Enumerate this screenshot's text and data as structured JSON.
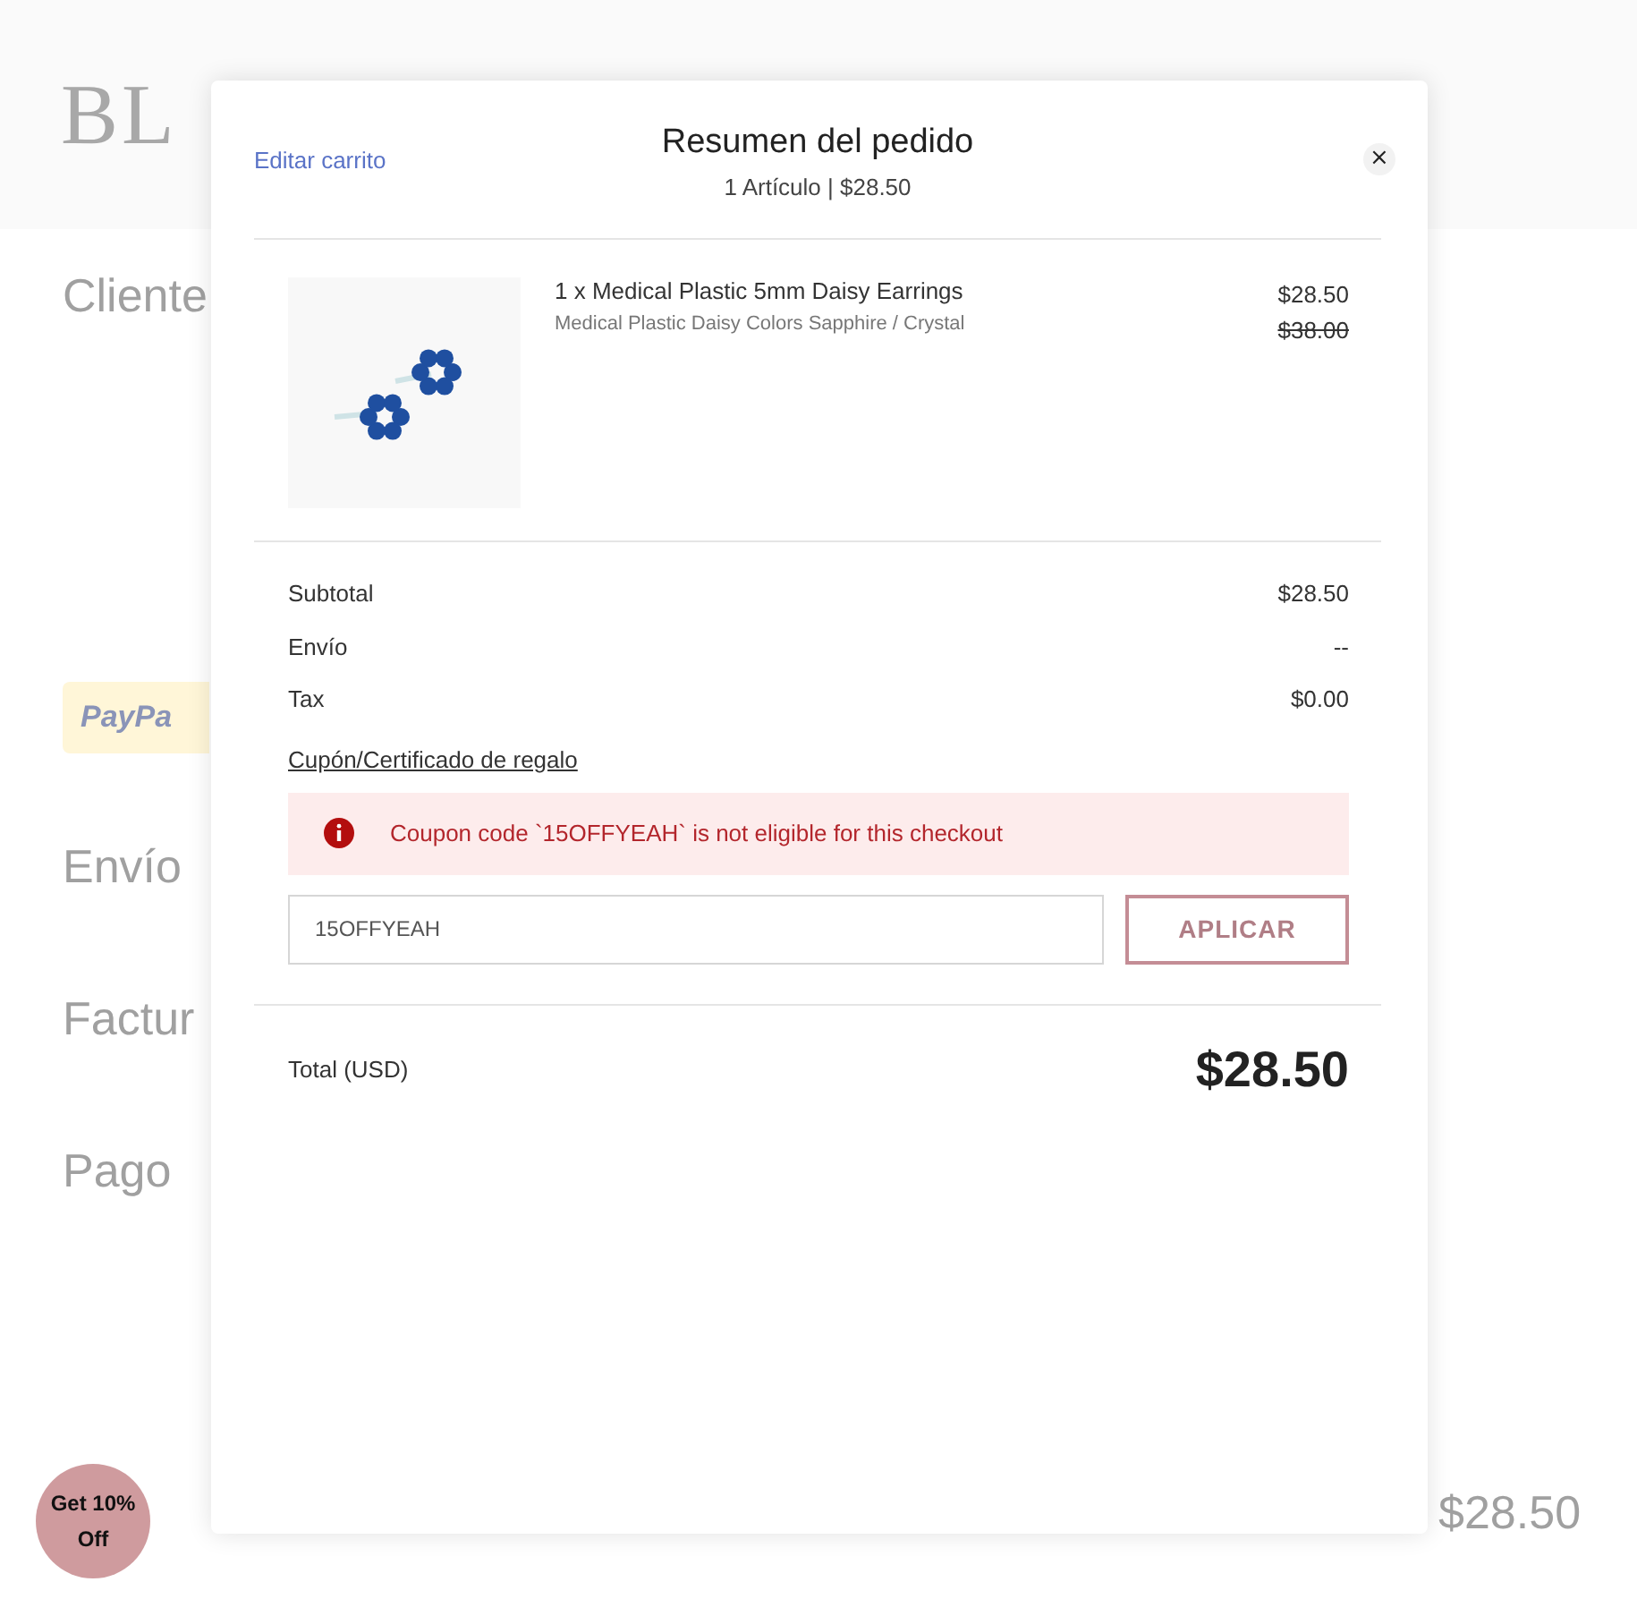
{
  "page": {
    "logo": "BL",
    "sections": [
      "Cliente",
      "Envío",
      "Factur",
      "Pago"
    ],
    "paypal": "PayPa",
    "price": "$28.50"
  },
  "modal": {
    "edit_link": "Editar carrito",
    "title": "Resumen del pedido",
    "subtitle": "1 Artículo | $28.50",
    "close": "×",
    "items": [
      {
        "name": "1 x Medical Plastic 5mm Daisy Earrings",
        "variant": "Medical Plastic Daisy Colors Sapphire / Crystal",
        "price": "$28.50",
        "original_price": "$38.00"
      }
    ],
    "summary": [
      {
        "label": "Subtotal",
        "value": "$28.50"
      },
      {
        "label": "Envío",
        "value": "--"
      },
      {
        "label": "Tax",
        "value": "$0.00"
      }
    ],
    "coupon_link": "Cupón/Certificado de regalo",
    "error": "Coupon code `15OFFYEAH` is not eligible for this checkout",
    "coupon_input": {
      "value": "15OFFYEAH"
    },
    "apply_button": "APLICAR",
    "total": {
      "label": "Total (USD)",
      "value": "$28.50"
    }
  },
  "promo_badge": "Get 10% Off"
}
